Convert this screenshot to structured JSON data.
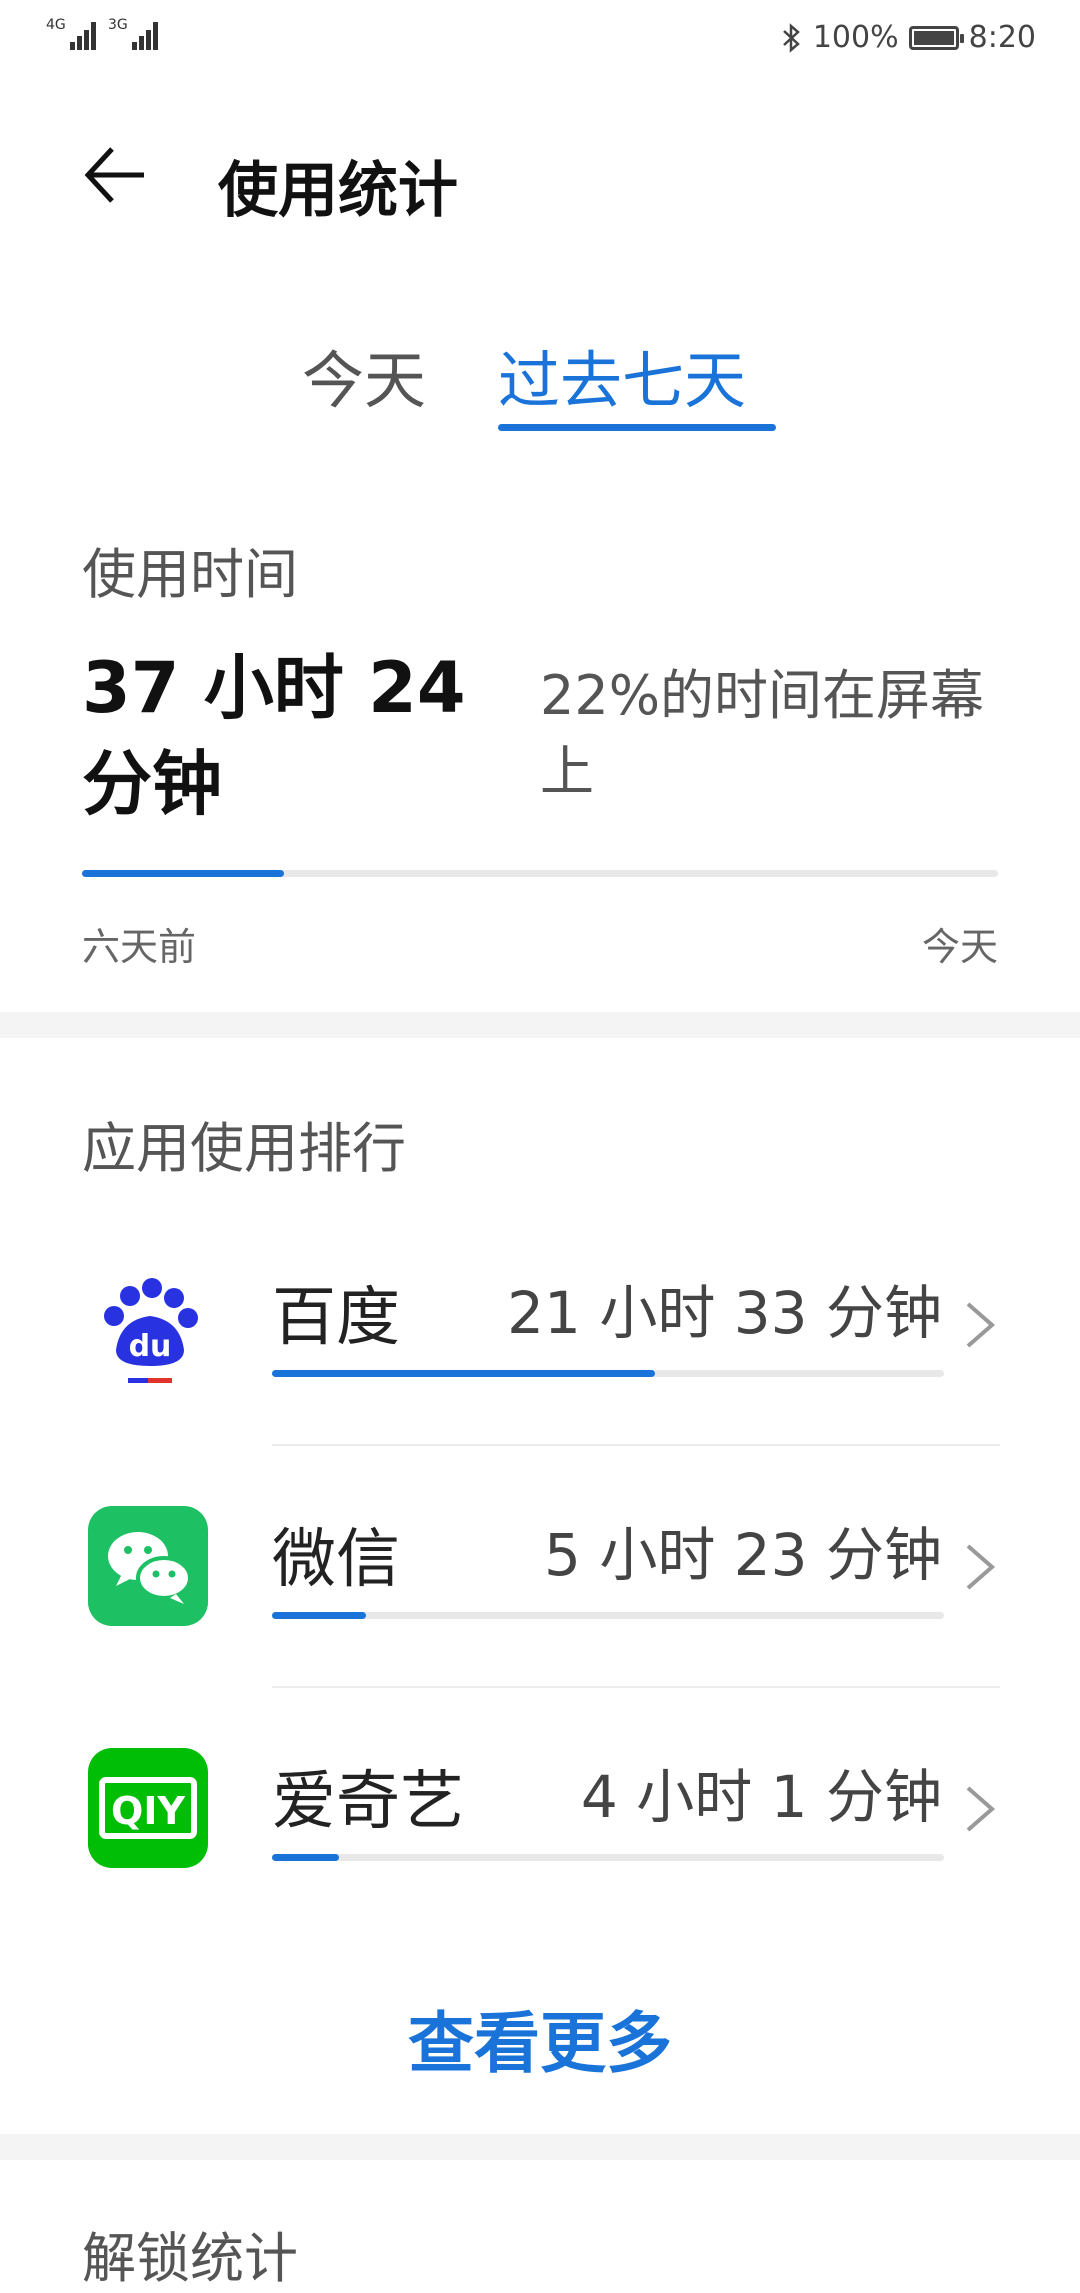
{
  "status_bar": {
    "sim1": "4G",
    "sim2": "3G",
    "bluetooth_icon": "bluetooth-icon",
    "battery_percent": "100%",
    "battery_level": 1.0,
    "time": "8:20"
  },
  "header": {
    "title": "使用统计",
    "back_icon": "arrow-left-icon"
  },
  "tabs": [
    {
      "label": "今天",
      "active": false
    },
    {
      "label": "过去七天",
      "active": true
    }
  ],
  "usage": {
    "section_label": "使用时间",
    "total_time": "37 小时 24 分钟",
    "screen_share": "22%的时间在屏幕上",
    "progress": 0.22,
    "axis_start": "六天前",
    "axis_end": "今天"
  },
  "ranking": {
    "section_label": "应用使用排行",
    "apps": [
      {
        "name": "百度",
        "duration": "21 小时 33 分钟",
        "share": 0.57,
        "icon": "baidu-icon",
        "color": "#2932e1"
      },
      {
        "name": "微信",
        "duration": "5 小时 23 分钟",
        "share": 0.14,
        "icon": "wechat-icon",
        "color": "#1dc063"
      },
      {
        "name": "爱奇艺",
        "duration": "4 小时 1 分钟",
        "share": 0.1,
        "icon": "iqiyi-icon",
        "color": "#00be06"
      }
    ],
    "see_more": "查看更多"
  },
  "bottom_section": {
    "label": "解锁统计"
  },
  "colors": {
    "accent": "#1a73d9",
    "track": "#e8e8e8"
  }
}
